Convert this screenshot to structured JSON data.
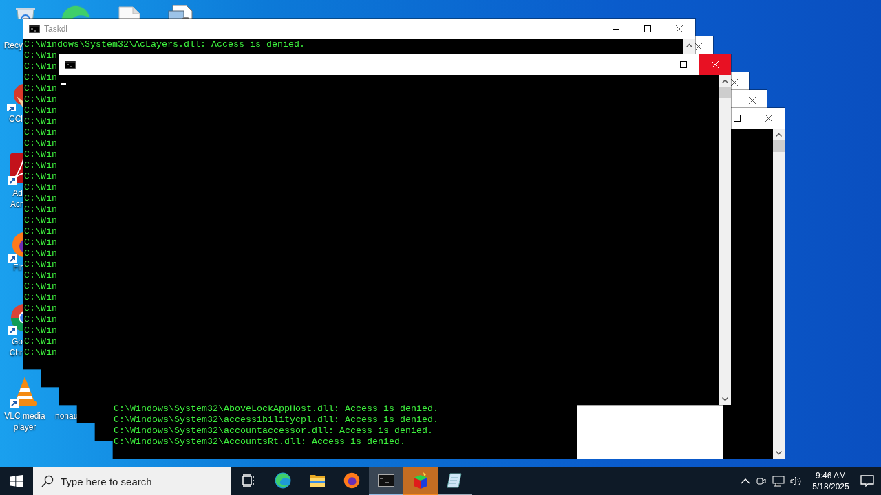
{
  "desktop_icons": [
    {
      "kind": "recycle",
      "label_lines": [
        "Recy"
      ]
    },
    {
      "kind": "edge"
    },
    {
      "kind": "file"
    },
    {
      "kind": "document"
    },
    {
      "kind": "ccleaner",
      "label_lines": [
        "CCl"
      ]
    },
    {
      "kind": "acrobat",
      "label_lines": [
        "Ad",
        "Acr"
      ]
    },
    {
      "kind": "firefox",
      "label_lines": [
        "Fir"
      ]
    },
    {
      "kind": "chrome",
      "label_lines": [
        "Go",
        "Chr"
      ]
    },
    {
      "kind": "vlc",
      "label_lines": [
        "VLC media",
        "player"
      ]
    },
    {
      "kind": "label",
      "label_lines": [
        "nonau"
      ]
    }
  ],
  "windows": [
    {
      "title": "Taskdl",
      "active": false,
      "lines": [
        "C:\\Windows\\System32\\AcLayers.dll: Access is denied.",
        "C:\\Win",
        "C:\\Win",
        "C:\\Win",
        "C:\\Win",
        "C:\\Win",
        "C:\\Win",
        "C:\\Win",
        "C:\\Win",
        "C:\\Win",
        "C:\\Win",
        "C:\\Win",
        "C:\\Win",
        "C:\\Win",
        "C:\\Win",
        "C:\\Win",
        "C:\\Win",
        "C:\\Win",
        "C:\\Win",
        "C:\\Win",
        "C:\\Win",
        "C:\\Win",
        "C:\\Win",
        "C:\\Win",
        "C:\\Win",
        "C:\\Win",
        "C:\\Win",
        "C:\\Win",
        "C:\\Win"
      ]
    },
    {
      "active": false
    },
    {
      "active": true,
      "cursor": true
    },
    {
      "active": false
    },
    {
      "active": false
    },
    {
      "lines": [
        "C:\\Windows\\System32\\AboveLockAppHost.dll: Access is denied.",
        "C:\\Windows\\System32\\accessibilitycpl.dll: Access is denied.",
        "C:\\Windows\\System32\\accountaccessor.dll: Access is denied.",
        "C:\\Windows\\System32\\AccountsRt.dll: Access is denied."
      ]
    }
  ],
  "taskbar": {
    "search": {
      "placeholder": "Type here to search"
    },
    "apps": [
      {
        "kind": "task-view",
        "selected": false,
        "flashing": false,
        "running": false
      },
      {
        "kind": "edge",
        "selected": false,
        "flashing": false,
        "running": false
      },
      {
        "kind": "folder",
        "selected": false,
        "flashing": false,
        "running": false
      },
      {
        "kind": "firefox",
        "selected": false,
        "flashing": false,
        "running": false
      },
      {
        "kind": "console",
        "selected": true,
        "flashing": false,
        "running": true
      },
      {
        "kind": "cube",
        "selected": false,
        "flashing": true,
        "running": true
      },
      {
        "kind": "notepad",
        "selected": false,
        "flashing": false,
        "running": true
      }
    ],
    "clock": {
      "time": "9:46 AM",
      "date": "5/18/2025"
    }
  }
}
